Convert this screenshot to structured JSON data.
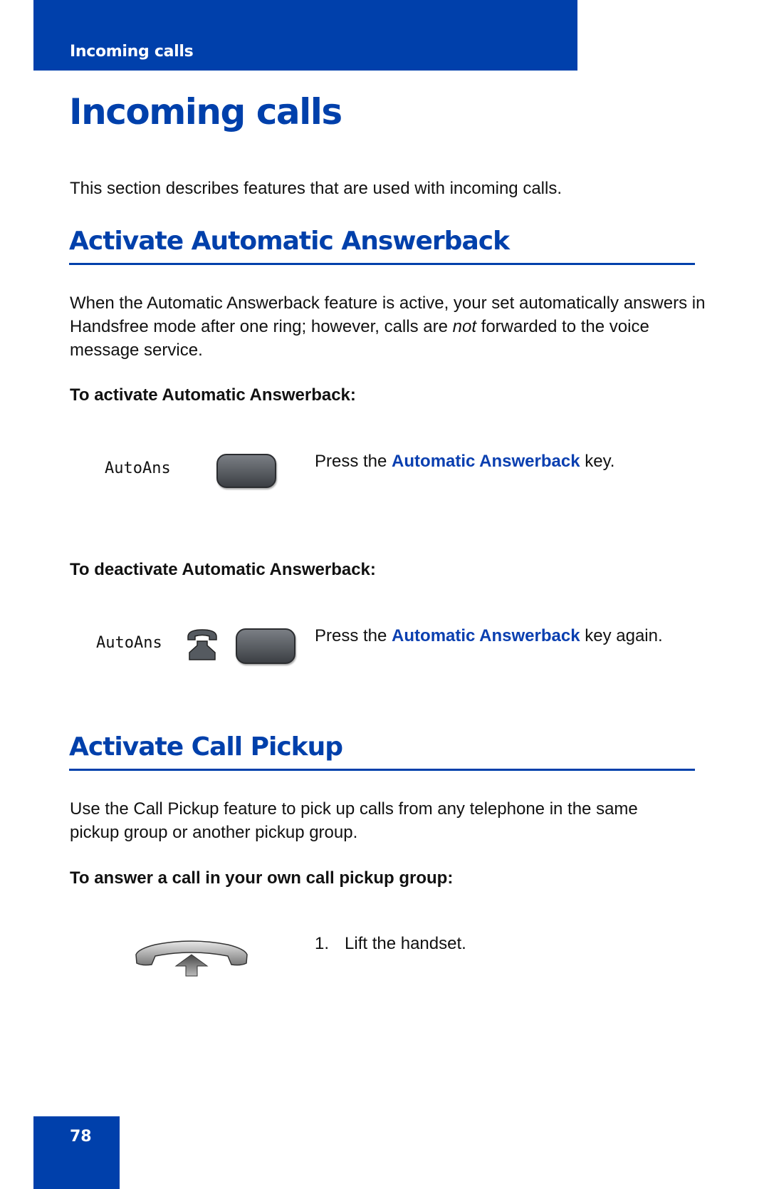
{
  "header": {
    "section_label": "Incoming calls"
  },
  "page": {
    "title": "Incoming calls",
    "intro": "This section describes features that are used with incoming calls.",
    "number": "78"
  },
  "sections": [
    {
      "heading": "Activate Automatic Answerback",
      "body": {
        "before_italic": "When the Automatic Answerback feature is active, your set automatically answers in Handsfree mode after one ring; however, calls are ",
        "italic": "not",
        "after_italic": " forwarded to the voice message service."
      },
      "procedures": [
        {
          "title": "To activate Automatic Answerback:",
          "display_label": "AutoAns",
          "icons": [
            "softkey-icon"
          ],
          "step": {
            "prefix": "Press the ",
            "key_name": "Automatic Answerback",
            "suffix": " key."
          }
        },
        {
          "title": "To deactivate Automatic Answerback:",
          "display_label": "AutoAns",
          "icons": [
            "handsfree-phone-icon",
            "softkey-icon"
          ],
          "step": {
            "prefix": "Press the ",
            "key_name": "Automatic Answerback",
            "suffix": " key again."
          }
        }
      ]
    },
    {
      "heading": "Activate Call Pickup",
      "body": "Use the Call Pickup feature to pick up calls from any telephone in the same pickup group or another pickup group.",
      "procedures": [
        {
          "title": "To answer a call in your own call pickup group:",
          "icons": [
            "lift-handset-icon"
          ],
          "steps": [
            {
              "number": "1.",
              "text": "Lift the handset."
            }
          ]
        }
      ]
    }
  ],
  "colors": {
    "brand_blue": "#0040ab",
    "key_text_blue": "#0a3fb0"
  }
}
